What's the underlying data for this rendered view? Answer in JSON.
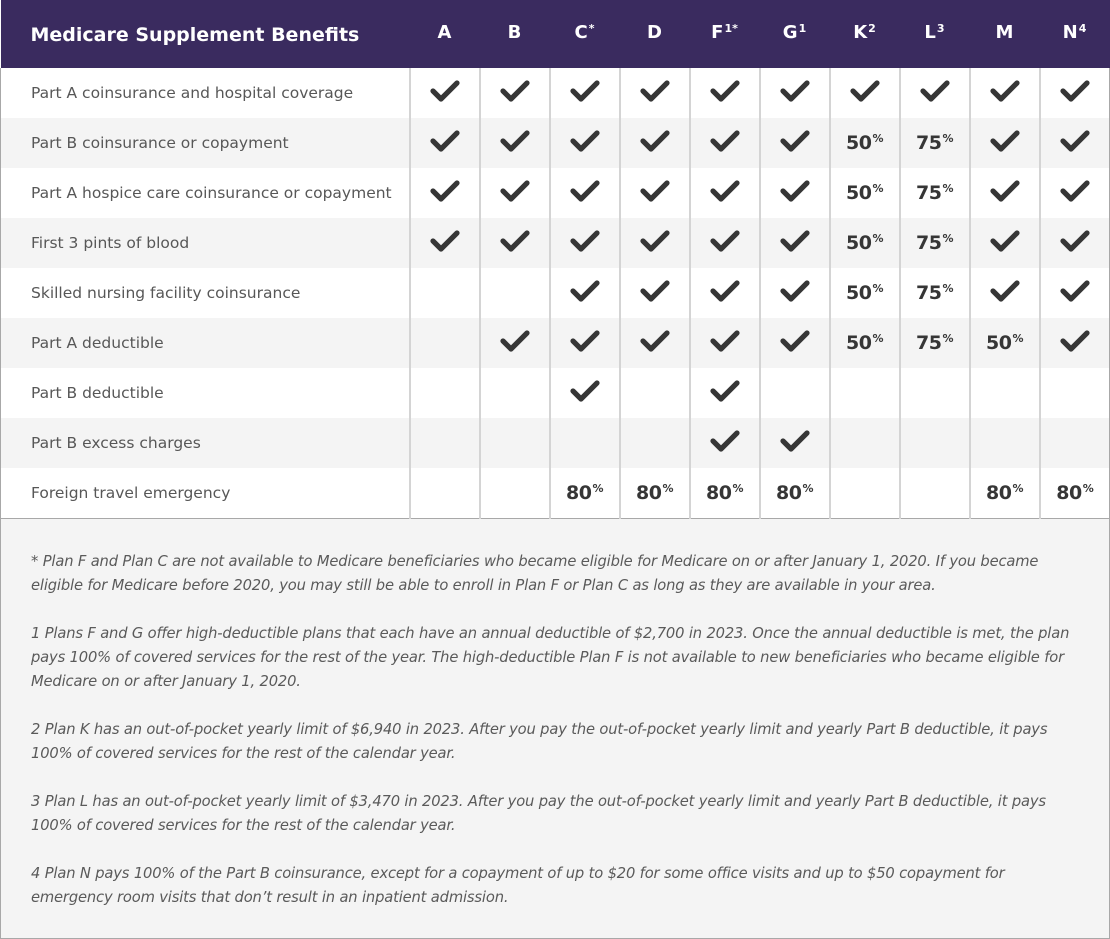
{
  "table": {
    "title": "Medicare Supplement Benefits",
    "plans": [
      {
        "letter": "A",
        "marker": ""
      },
      {
        "letter": "B",
        "marker": ""
      },
      {
        "letter": "C",
        "marker": "*"
      },
      {
        "letter": "D",
        "marker": ""
      },
      {
        "letter": "F",
        "marker": "1*"
      },
      {
        "letter": "G",
        "marker": "1"
      },
      {
        "letter": "K",
        "marker": "2"
      },
      {
        "letter": "L",
        "marker": "3"
      },
      {
        "letter": "M",
        "marker": ""
      },
      {
        "letter": "N",
        "marker": "4"
      }
    ],
    "rows": [
      {
        "label": "Part A coinsurance and hospital coverage",
        "cells": [
          "check",
          "check",
          "check",
          "check",
          "check",
          "check",
          "check",
          "check",
          "check",
          "check"
        ]
      },
      {
        "label": "Part B coinsurance or copayment",
        "cells": [
          "check",
          "check",
          "check",
          "check",
          "check",
          "check",
          "50",
          "75",
          "check",
          "check"
        ]
      },
      {
        "label": "Part A hospice care coinsurance or copayment",
        "cells": [
          "check",
          "check",
          "check",
          "check",
          "check",
          "check",
          "50",
          "75",
          "check",
          "check"
        ]
      },
      {
        "label": "First 3 pints of blood",
        "cells": [
          "check",
          "check",
          "check",
          "check",
          "check",
          "check",
          "50",
          "75",
          "check",
          "check"
        ]
      },
      {
        "label": "Skilled nursing facility coinsurance",
        "cells": [
          "",
          "",
          "check",
          "check",
          "check",
          "check",
          "50",
          "75",
          "check",
          "check"
        ]
      },
      {
        "label": "Part A deductible",
        "cells": [
          "",
          "check",
          "check",
          "check",
          "check",
          "check",
          "50",
          "75",
          "50",
          "check"
        ]
      },
      {
        "label": "Part B deductible",
        "cells": [
          "",
          "",
          "check",
          "",
          "check",
          "",
          "",
          "",
          "",
          ""
        ]
      },
      {
        "label": "Part B excess charges",
        "cells": [
          "",
          "",
          "",
          "",
          "check",
          "check",
          "",
          "",
          "",
          ""
        ]
      },
      {
        "label": "Foreign travel emergency",
        "cells": [
          "",
          "",
          "80",
          "80",
          "80",
          "80",
          "",
          "",
          "80",
          "80"
        ]
      }
    ],
    "percent_symbol": "%",
    "check_icon": "check-icon",
    "colors": {
      "header_bg": "#3a2b5f",
      "header_text": "#ffffff",
      "check": "#363636",
      "row_alt": "#f4f4f4"
    }
  },
  "footnotes": [
    "* Plan F and Plan C are not available to Medicare beneficiaries who became eligible for Medicare on or after January 1, 2020. If you became eligible for Medicare before 2020, you may still be able to enroll in Plan F or Plan C as long as they are available in your area.",
    "1 Plans F and G offer high-deductible plans that each have an annual deductible of $2,700 in 2023. Once the annual deductible is met, the plan pays 100% of covered services for the rest of the year. The high-deductible Plan F is not available to new beneficiaries who became eligible for Medicare on or after January 1, 2020.",
    "2 Plan K has an out-of-pocket yearly limit of $6,940 in 2023. After you pay the out-of-pocket yearly limit and yearly Part B deductible, it pays 100% of covered services for the rest of the calendar year.",
    "3 Plan L has an out-of-pocket yearly limit of $3,470 in 2023. After you pay the out-of-pocket yearly limit and yearly Part B deductible, it pays 100% of covered services for the rest of the calendar year.",
    "4 Plan N pays 100% of the Part B coinsurance, except for a copayment of up to $20 for some office visits and up to $50 copayment for emergency room visits that don’t result in an inpatient admission."
  ]
}
